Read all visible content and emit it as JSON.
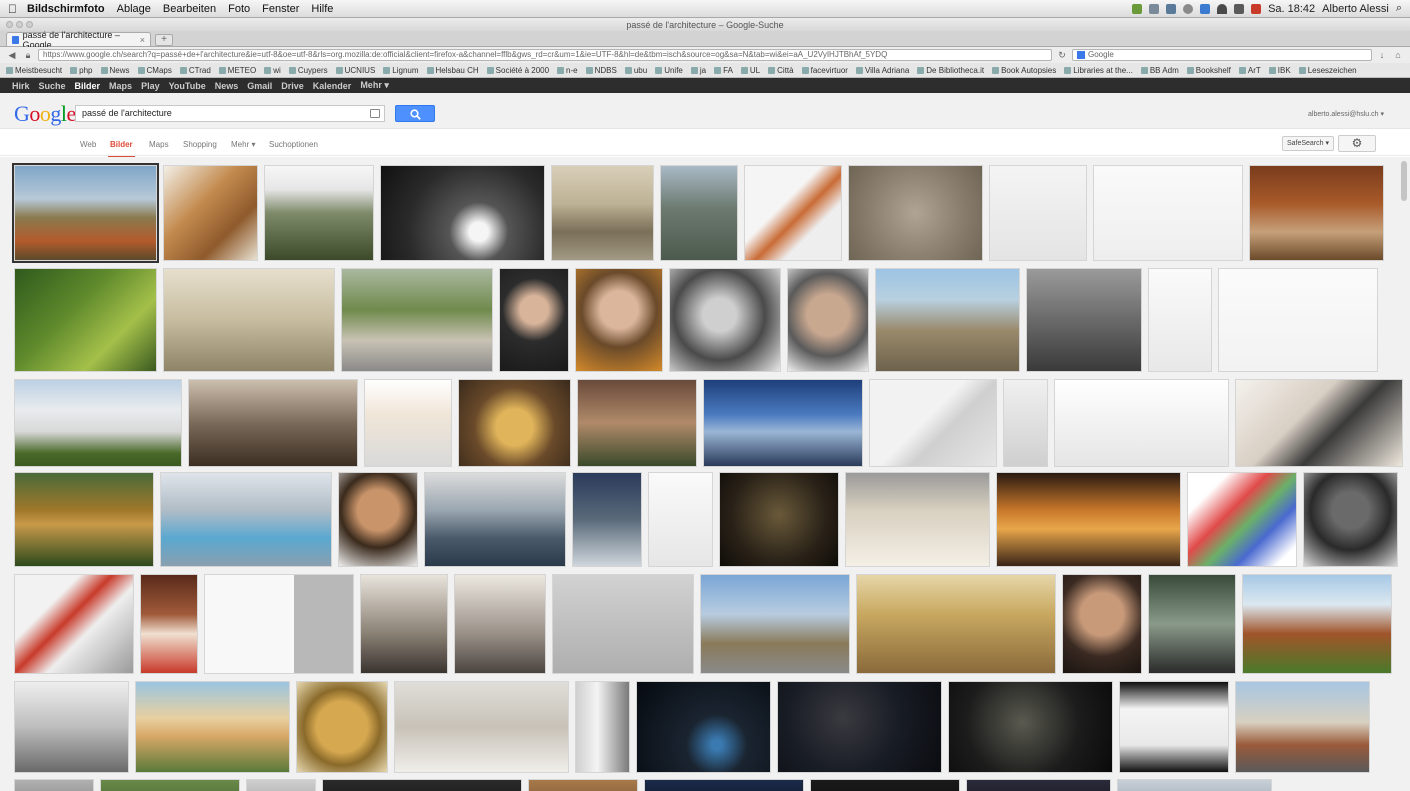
{
  "menubar": {
    "app": "Bildschirmfoto",
    "items": [
      "Ablage",
      "Bearbeiten",
      "Foto",
      "Fenster",
      "Hilfe"
    ],
    "clock": "Sa. 18:42",
    "user": "Alberto Alessi"
  },
  "window": {
    "title": "passé de l'architecture – Google-Suche"
  },
  "tabs": [
    {
      "label": "passé de l'architecture – Google..."
    }
  ],
  "browser": {
    "url": "https://www.google.ch/search?q=passé+de+l'architecture&ie=utf-8&oe=utf-8&rls=org.mozilla:de:official&client=firefox-a&channel=fflb&gws_rd=cr&um=1&ie=UTF-8&hl=de&tbm=isch&source=og&sa=N&tab=wi&ei=aA_U2VyIHJTBhAf_5YDQ",
    "search_placeholder": "Google"
  },
  "bookmarks": [
    "Meistbesucht",
    "php",
    "News",
    "CMaps",
    "CTrad",
    "METEO",
    "wi",
    "Cuypers",
    "UCNIUS",
    "Lignum",
    "Helsbau CH",
    "Société à 2000",
    "n-e",
    "NDBS",
    "ubu",
    "Unife",
    "ja",
    "FA",
    "UL",
    "Città",
    "facevirtuor",
    "Villa Adriana",
    "De Bibliotheca.it",
    "Book Autopsies",
    "Libraries at the...",
    "BB Adm",
    "Bookshelf",
    "ArT",
    "IBK",
    "Leseszeichen"
  ],
  "gbar": {
    "items": [
      {
        "label": "Hirk"
      },
      {
        "label": "Suche"
      },
      {
        "label": "Bilder",
        "active": true
      },
      {
        "label": "Maps"
      },
      {
        "label": "Play"
      },
      {
        "label": "YouTube"
      },
      {
        "label": "News"
      },
      {
        "label": "Gmail"
      },
      {
        "label": "Drive"
      },
      {
        "label": "Kalender"
      },
      {
        "label": "Mehr ▾"
      }
    ]
  },
  "google": {
    "logo": "Google",
    "query": "passé de l'architecture",
    "user_email": "alberto.alessi@hslu.ch ▾",
    "logo_colors": [
      "#3369e8",
      "#d50f25",
      "#eeb211",
      "#3369e8",
      "#009925",
      "#d50f25"
    ]
  },
  "search_tabs": [
    {
      "label": "Web"
    },
    {
      "label": "Bilder",
      "active": true
    },
    {
      "label": "Maps"
    },
    {
      "label": "Shopping"
    },
    {
      "label": "Mehr ▾"
    },
    {
      "label": "Suchoptionen"
    }
  ],
  "safesearch_label": "SafeSearch ▾",
  "settings_icon": "gear-icon",
  "colors": {
    "accent_red": "#dd4b39",
    "search_blue": "#4d90fe",
    "gbar": "#2d2d2d"
  },
  "image_rows": [
    [
      {
        "fill": "linear-gradient(#7fa6c8 0%,#b7c9d8 35%,#8a7a4e 55%,#b35a2c 80%,#5b4b2a 100%)",
        "selected": true
      },
      {
        "fill": "linear-gradient(135deg,#f2efe6 0%,#c38a4e 40%,#8f5a2c 70%,#e9e2d2 100%)"
      },
      {
        "fill": "linear-gradient(#f6f6f6 0%,#e6e6e6 25%,#7e8a6a 50%,#3c4a2a 100%)"
      },
      {
        "fill": "radial-gradient(circle at 60% 70%,#f5f5f5 0 8%,#555 25%,#2a2a2a 60%,#111 100%)"
      },
      {
        "fill": "linear-gradient(#d8cfb8 0%,#bdb295 40%,#7a6f58 70%,#a29a84 100%)"
      },
      {
        "fill": "linear-gradient(#a9b9c6 0%,#6c7a70 45%,#4c5a4e 100%)"
      },
      {
        "fill": "linear-gradient(135deg,#f5f5f5 0 40%,#c96b36 55%,#eeeeee 70%)"
      },
      {
        "fill": "radial-gradient(circle at 50% 50%,#b0a494 0,#8e8272 50%,#6f6555 100%)"
      },
      {
        "fill": "linear-gradient(#f4f4f4,#e4e4e4)"
      },
      {
        "fill": "linear-gradient(#fafafa,#eeeeee)"
      },
      {
        "fill": "linear-gradient(#7a3c1c 0%,#a85a2a 40%,#c6a07a 70%,#6b4a2a 100%)"
      }
    ],
    [
      {
        "fill": "linear-gradient(135deg,#2f5a1c 0%,#5f8a2c 40%,#a4c04a 70%,#3b5a20 100%)"
      },
      {
        "fill": "linear-gradient(#e6dfcc 0%,#c7bca0 50%,#8f8468 100%)"
      },
      {
        "fill": "linear-gradient(#aab8a0 0%,#6f8a4c 40%,#c9c2b4 70%,#8a8a8a 100%)"
      },
      {
        "fill": "radial-gradient(circle at 50% 40%,#d8b49a 0 20%,#2c2c2c 45%,#1a1a1a 100%)"
      },
      {
        "fill": "radial-gradient(circle at 50% 40%,#dcb69c 0 25%,#6a4a2a 50%,#d48a2a 100%)"
      },
      {
        "fill": "radial-gradient(circle at 45% 45%,#cfcfcf 0 20%,#4a4a4a 55%,#e8e8e8 100%)"
      },
      {
        "fill": "radial-gradient(circle at 50% 45%,#c9a890 0 30%,#5a5a5a 60%,#eeeeee 100%)"
      },
      {
        "fill": "linear-gradient(#9cc4e4 0%,#b8d0e0 30%,#9a8a6c 60%,#6e624c 100%)"
      },
      {
        "fill": "linear-gradient(#9a9a9a 0%,#6a6a6a 50%,#3a3a3a 100%)"
      },
      {
        "fill": "linear-gradient(#fafafa,#e8e8e8)"
      },
      {
        "fill": "linear-gradient(#fbfbfb,#f2f2f2)"
      }
    ],
    [
      {
        "fill": "linear-gradient(#bcd0e4 0%,#e9ecee 35%,#d8d8d8 60%,#4a6a2a 85%,#3a5a20 100%)"
      },
      {
        "fill": "linear-gradient(#cdbfae 0%,#7a6a5a 50%,#3c2e22 100%)"
      },
      {
        "fill": "linear-gradient(#ffffff 0%,#f0e6d8 40%,#d9d9d9 100%)"
      },
      {
        "fill": "radial-gradient(circle at 50% 55%,#e0b45a 0 25%,#6a4a2a 55%,#3a2a1c 100%)"
      },
      {
        "fill": "linear-gradient(#6a4a3a 0%,#b08a6a 50%,#3a4a2a 100%)"
      },
      {
        "fill": "linear-gradient(#1e3f7a 0%,#4a7ac0 40%,#9ab6d6 60%,#2a3a5a 100%)"
      },
      {
        "fill": "linear-gradient(135deg,#f2f2f2 0 45%,#cfcfcf 60%,#e6e6e6 100%)"
      },
      {
        "fill": "linear-gradient(#f0f0f0,#cfcfcf)"
      },
      {
        "fill": "linear-gradient(#ffffff,#e5e5e5)"
      },
      {
        "fill": "linear-gradient(135deg,#f4f1ec 0%,#d8cfc4 40%,#3a3a3a 60%,#efe8dd 100%)"
      }
    ],
    [
      {
        "fill": "linear-gradient(#4a6a3a 0%,#a0782a 40%,#c89a4a 55%,#2e4a1c 100%)"
      },
      {
        "fill": "linear-gradient(#dfe4ea 0%,#b0bcc6 40%,#5aa8d0 70%,#8aa0b0 100%)"
      },
      {
        "fill": "radial-gradient(circle at 50% 40%,#c9946a 0 30%,#3a2a1c 55%,#eeeeee 100%)"
      },
      {
        "fill": "linear-gradient(#dcdcdc 0%,#9aa6b0 40%,#4a5a6a 70%,#2a3a4a 100%)"
      },
      {
        "fill": "linear-gradient(#2a3a5a 0%,#5a6a7a 50%,#cfd6dc 100%)"
      },
      {
        "fill": "linear-gradient(#fafafa,#e6e6e6)"
      },
      {
        "fill": "radial-gradient(circle at 50% 45%,#6a5a3a 0,#2a2218 60%,#0e0c08 100%)"
      },
      {
        "fill": "linear-gradient(#9a9a9a 0%,#d8d0c0 40%,#f4efe6 100%)"
      },
      {
        "fill": "linear-gradient(#2a1a12 0%,#c8782a 40%,#e8a64a 60%,#3a2418 100%)"
      },
      {
        "fill": "linear-gradient(135deg,#ffffff 0 20%,#e24a4a 40%,#6ab06a 55%,#4a6ad0 70%,#ffffff 90%)"
      },
      {
        "fill": "radial-gradient(circle at 50% 40%,#6a6a6a 0 25%,#2a2a2a 55%,#d8d8d8 100%)"
      }
    ],
    [
      {
        "fill": "linear-gradient(135deg,#f2f2f2 0 30%,#c83a2a 45%,#eeeeee 60%,#9a9a9a 100%)"
      },
      {
        "fill": "linear-gradient(#5a2a1a 0%,#a05a3a 40%,#f0e0d0 60%,#c83a2a 100%)"
      },
      {
        "fill": "linear-gradient(90deg,#f8f8f8 0 60%,#b8b8b8 60%)"
      },
      {
        "fill": "linear-gradient(#e8e4dc 0%,#8a8074 60%,#3a3430 100%)"
      },
      {
        "fill": "linear-gradient(#ece8e0 0%,#9a9088 60%,#4a4440 100%)"
      },
      {
        "fill": "linear-gradient(#d2d2d2,#aeaeae)"
      },
      {
        "fill": "linear-gradient(#7aa6d6 0%,#b8cce0 40%,#8a7a5a 70%,#8a8a8a 100%)"
      },
      {
        "fill": "linear-gradient(#e6d6a8 0%,#c8a860 40%,#8a6a3a 100%)"
      },
      {
        "fill": "radial-gradient(circle at 50% 40%,#c89a7a 0 30%,#3a2a22 60%,#1a1410 100%)"
      },
      {
        "fill": "linear-gradient(#3a4a3a 0%,#8a9a8a 50%,#2a2a2a 100%)"
      },
      {
        "fill": "linear-gradient(#a6c8e6 0%,#dce8f0 30%,#a0542a 60%,#4a7a2a 100%)"
      }
    ],
    [
      {
        "fill": "linear-gradient(#eeeeee 0%,#bdbdbd 50%,#6a6a6a 100%)"
      },
      {
        "fill": "linear-gradient(#9ac4e0 0%,#e8d0a0 40%,#d8a868 60%,#5a7a3a 100%)"
      },
      {
        "fill": "radial-gradient(circle at 50% 50%,#d6a850 0 40%,#8a6a2a 60%,#e6d8b0 100%)"
      },
      {
        "fill": "linear-gradient(#e0ded8 0%,#c8c2b8 50%,#f0eeea 100%)"
      },
      {
        "fill": "linear-gradient(90deg,#cfcfcf 0%,#f4f4f4 40%,#7a7a7a 100%)"
      },
      {
        "fill": "radial-gradient(circle at 60% 70%,#3a7ab0 0 5%,#1a2430 30%,#060a10 100%)"
      },
      {
        "fill": "radial-gradient(circle at 40% 40%,#3a3a40 0,#181c24 50%,#0a0c10 100%)"
      },
      {
        "fill": "radial-gradient(circle at 45% 45%,#5a5a50 0,#1c1c1c 55%,#0a0a0a 100%)"
      },
      {
        "fill": "linear-gradient(#0e0e0e 0%,#f4f4f4 30%,#e8e8e8 70%,#101010 100%)"
      },
      {
        "fill": "linear-gradient(#a8c6e2 0%,#d8d0c0 45%,#9a5a3a 70%,#5a5a5a 100%)"
      }
    ],
    [
      {
        "fill": "linear-gradient(#b0b0b0,#7a7a7a)"
      },
      {
        "fill": "linear-gradient(#6a8a4a,#3a5a2a)"
      },
      {
        "fill": "linear-gradient(#cfcfcf,#9a9a9a)"
      },
      {
        "fill": "linear-gradient(#2a2a2a,#111111)"
      },
      {
        "fill": "linear-gradient(#a87a4a,#6a4a2a)"
      },
      {
        "fill": "linear-gradient(#1a2a4a,#0a1020)"
      },
      {
        "fill": "linear-gradient(#1a1a1a,#0a0a0a)"
      },
      {
        "fill": "linear-gradient(#2a2a3a,#101018)"
      },
      {
        "fill": "linear-gradient(#c8d0d8,#8a9aa8)"
      }
    ]
  ]
}
